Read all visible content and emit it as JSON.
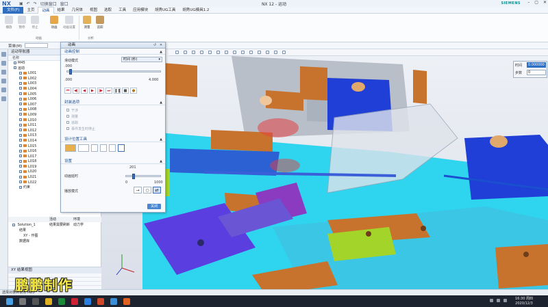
{
  "app": {
    "logo": "NX",
    "window_title": "NX 12 - 运动",
    "brand": "SIEMENS",
    "quick_access": [
      "切换窗口",
      "窗口"
    ]
  },
  "menu": {
    "file": "文件(F)",
    "tabs": [
      "主页",
      "动画",
      "结果",
      "几何体",
      "视图",
      "选取",
      "工具",
      "应用模块",
      "胡秀UG工具",
      "胡秀UG模具1.2"
    ],
    "active_tab": "动画"
  },
  "ribbon": {
    "buttons": [
      "播放",
      "暂停",
      "停止",
      "动画",
      "动画设置",
      "测量",
      "追踪"
    ],
    "groups": [
      "动画",
      "分析"
    ]
  },
  "selection_bar": {
    "menu_label": "菜单(M)"
  },
  "navigator": {
    "title": "运动导航器",
    "col_name": "名称",
    "tree": [
      {
        "label": "M45",
        "indent": 1,
        "link": false
      },
      {
        "label": "运动",
        "indent": 1,
        "link": false
      },
      {
        "label": "L001",
        "indent": 2,
        "link": true
      },
      {
        "label": "L002",
        "indent": 2,
        "link": true
      },
      {
        "label": "L003",
        "indent": 2,
        "link": true
      },
      {
        "label": "L004",
        "indent": 2,
        "link": true
      },
      {
        "label": "L005",
        "indent": 2,
        "link": true
      },
      {
        "label": "L006",
        "indent": 2,
        "link": true
      },
      {
        "label": "L007",
        "indent": 2,
        "link": true
      },
      {
        "label": "L008",
        "indent": 2,
        "link": true
      },
      {
        "label": "L009",
        "indent": 2,
        "link": true
      },
      {
        "label": "L010",
        "indent": 2,
        "link": true
      },
      {
        "label": "L011",
        "indent": 2,
        "link": true
      },
      {
        "label": "L012",
        "indent": 2,
        "link": true
      },
      {
        "label": "L013",
        "indent": 2,
        "link": true
      },
      {
        "label": "L014",
        "indent": 2,
        "link": true
      },
      {
        "label": "L015",
        "indent": 2,
        "link": true
      },
      {
        "label": "L016",
        "indent": 2,
        "link": true
      },
      {
        "label": "L017",
        "indent": 2,
        "link": true
      },
      {
        "label": "L018",
        "indent": 2,
        "link": true
      },
      {
        "label": "L019",
        "indent": 2,
        "link": true
      },
      {
        "label": "L020",
        "indent": 2,
        "link": true
      },
      {
        "label": "L021",
        "indent": 2,
        "link": true
      },
      {
        "label": "L022",
        "indent": 2,
        "link": true
      },
      {
        "label": "约束",
        "indent": 2,
        "link": false
      }
    ],
    "solution": {
      "name": "Solution_1",
      "col_active": "活动",
      "col_type": "环境",
      "status": "结果需要刷新",
      "type": "动力学",
      "children": [
        "结果",
        "XY - 作图",
        "数据库"
      ]
    },
    "xy_panel_title": "XY 结果视图"
  },
  "dialog": {
    "title": "动画",
    "sec_control": "动画控制",
    "mode_label": "滑动模式",
    "mode_value": "时间 (秒)",
    "slider_start": ".000",
    "slider_min": ".000",
    "slider_max": "4.000",
    "slider_fraction": 0.02,
    "sec_package": "封装选项",
    "options": [
      "干涉",
      "测量",
      "追踪",
      "事件发生时停止"
    ],
    "sec_design": "设计位置工具",
    "sec_settings": "设置",
    "steps_label": "动画延时",
    "steps_value": "201",
    "delay_min": "0",
    "delay_max": "1000",
    "delay_fraction": 0.2,
    "playback_label": "播放模式",
    "close_label": "关闭"
  },
  "step_panel": {
    "time_label": "时间",
    "time_value": "0.000000",
    "step_label": "步数",
    "step_value": "0"
  },
  "statusbar": {
    "text": "选择对象并使用 MB3"
  },
  "watermark": "鹏鹏制作",
  "taskbar": {
    "time": "16:30 周四",
    "date": "2020/12/3"
  },
  "colors": {
    "brand_blue": "#2f6fbf",
    "model_orange": "#c8732d",
    "model_blue": "#1f3fd6",
    "model_purple": "#7d3bb5",
    "model_cyan": "#2fd4ef",
    "model_green": "#a3d42a"
  }
}
